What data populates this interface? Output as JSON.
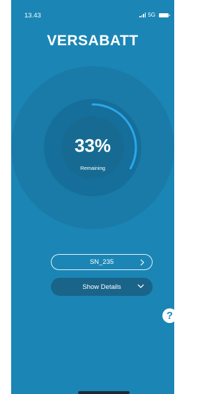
{
  "status_bar": {
    "time": "13.43",
    "network": "5G"
  },
  "brand": {
    "logo_text": "VERSABATT"
  },
  "battery_gauge": {
    "percent_text": "33%",
    "level": 0.33,
    "label": "Remaining"
  },
  "device_selector": {
    "serial": "SN_235"
  },
  "details_toggle": {
    "label": "Show Details"
  },
  "help": {
    "symbol": "?"
  },
  "colors": {
    "background": "#1b86b5",
    "gauge_arc": "#2aa7ea",
    "button_dark": "#1a648a"
  },
  "icons": [
    "signal-icon",
    "battery-icon",
    "chevron-right-icon",
    "chevron-down-icon",
    "help-icon"
  ]
}
